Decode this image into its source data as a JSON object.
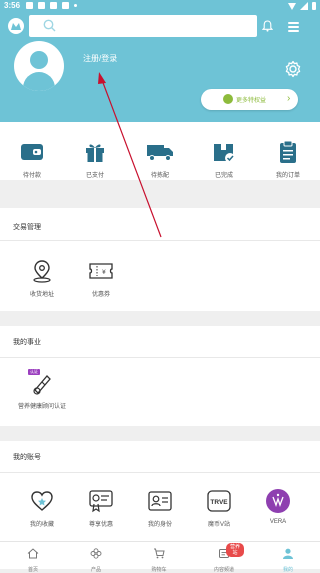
{
  "status_bar": {
    "time": "3:56"
  },
  "header": {
    "login_label": "注册/登录",
    "rights_label": "更多特权益"
  },
  "orders": [
    {
      "label": "待付款",
      "icon": "wallet-icon"
    },
    {
      "label": "已支付",
      "icon": "gift-icon"
    },
    {
      "label": "待拣配",
      "icon": "truck-icon"
    },
    {
      "label": "已完成",
      "icon": "box-check-icon"
    },
    {
      "label": "我的订单",
      "icon": "clipboard-icon"
    }
  ],
  "transactions": {
    "title": "交易管理",
    "items": [
      {
        "label": "收货地址",
        "icon": "location-icon"
      },
      {
        "label": "优惠券",
        "icon": "coupon-icon"
      }
    ]
  },
  "career": {
    "title": "我的事业",
    "items": [
      {
        "label": "营养健康顾问认证",
        "icon": "certificate-icon",
        "tag": "认证"
      }
    ]
  },
  "account": {
    "title": "我的账号",
    "items": [
      {
        "label": "我的收藏",
        "icon": "heart-icon"
      },
      {
        "label": "尊享优惠",
        "icon": "vip-card-icon"
      },
      {
        "label": "我的身份",
        "icon": "id-card-icon"
      },
      {
        "label": "魔币V站",
        "icon": "trve-icon",
        "logo_text": "TRVE"
      },
      {
        "label": "VERA",
        "icon": "vera-icon"
      }
    ]
  },
  "tabbar": [
    {
      "label": "首页",
      "icon": "home-icon"
    },
    {
      "label": "产品",
      "icon": "flower-icon"
    },
    {
      "label": "购物车",
      "icon": "cart-icon"
    },
    {
      "label": "内容频道",
      "icon": "content-icon",
      "badge": "营养站"
    },
    {
      "label": "我的",
      "icon": "user-icon",
      "active": true
    }
  ],
  "colors": {
    "accent": "#6ec3d6",
    "icon_dark": "#2a6f8a",
    "badge": "#e84a4a",
    "rights_green": "#8dbb3c"
  }
}
